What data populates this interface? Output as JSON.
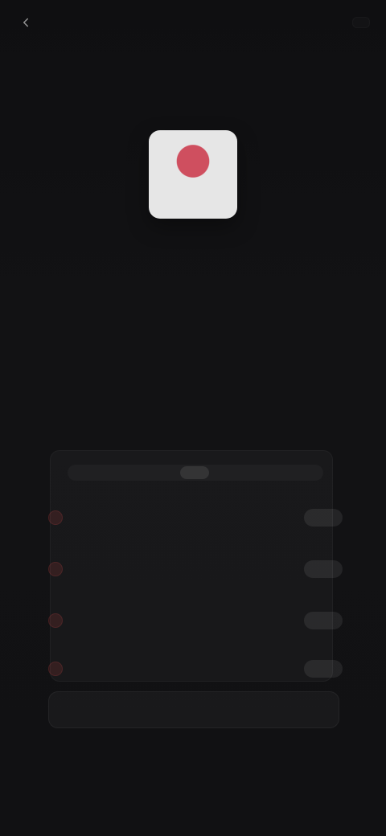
{
  "topbar": {
    "back_label": "",
    "action_label": ""
  },
  "header": {
    "title": ""
  },
  "section1": {
    "label": "",
    "text_line1": "",
    "text_line2": ""
  },
  "block": {
    "title": "",
    "description": ""
  },
  "rows": [
    {
      "label": "",
      "pill": ""
    },
    {
      "label": "",
      "pill": ""
    },
    {
      "label": "",
      "pill": ""
    },
    {
      "label": "",
      "pill": ""
    }
  ],
  "primary_button": {
    "label": ""
  },
  "footer": {
    "link": "",
    "corner": ""
  }
}
